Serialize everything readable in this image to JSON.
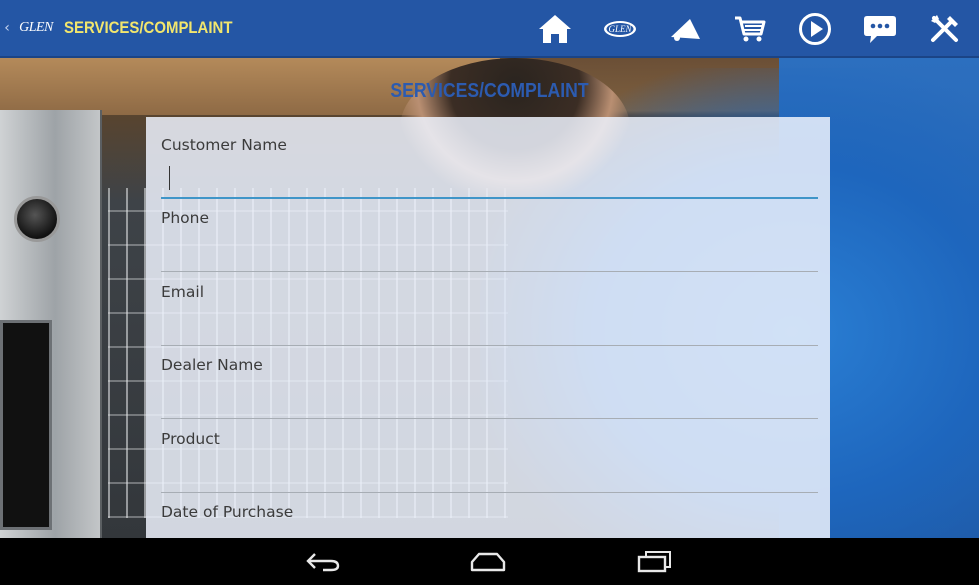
{
  "appbar": {
    "back_glyph": "‹",
    "logo_text": "GLEN",
    "title": "SERVICES/COMPLAINT",
    "bg_color": "#2456a5",
    "title_color": "#f2e66d",
    "icons": [
      "home-icon",
      "glen-logo-icon",
      "megaphone-icon",
      "shopping-cart-icon",
      "play-icon",
      "chat-icon",
      "tools-icon"
    ]
  },
  "page": {
    "heading": "SERVICES/COMPLAINT",
    "heading_color": "#2c5bb0"
  },
  "form": {
    "fields": [
      {
        "label": "Customer Name",
        "value": "",
        "focused": true
      },
      {
        "label": "Phone",
        "value": ""
      },
      {
        "label": "Email",
        "value": ""
      },
      {
        "label": "Dealer Name",
        "value": ""
      },
      {
        "label": "Product",
        "value": ""
      },
      {
        "label": "Date of Purchase",
        "value": ""
      }
    ],
    "accent_color": "#3f95c8"
  },
  "system_nav": {
    "buttons": [
      "back-icon",
      "home-icon",
      "recent-apps-icon"
    ]
  }
}
